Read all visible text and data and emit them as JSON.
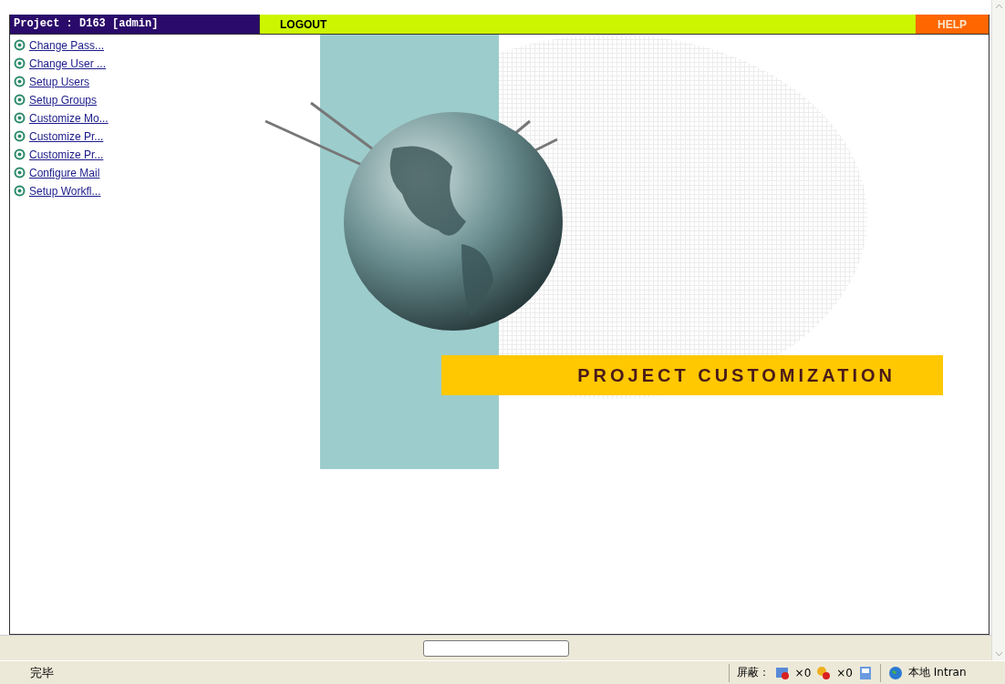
{
  "header": {
    "title": "Project : D163 [admin]",
    "logout": "LOGOUT",
    "help": "HELP"
  },
  "menu": [
    {
      "label": "Change Pass..."
    },
    {
      "label": "Change User ..."
    },
    {
      "label": "Setup Users"
    },
    {
      "label": "Setup Groups"
    },
    {
      "label": "Customize Mo..."
    },
    {
      "label": "Customize Pr..."
    },
    {
      "label": "Customize Pr..."
    },
    {
      "label": "Configure Mail"
    },
    {
      "label": "Setup Workfl..."
    }
  ],
  "banner": "PROJECT CUSTOMIZATION",
  "status_bar": {
    "message": "完毕",
    "blocked_label": "屏蔽：",
    "popups_blocked": "×0",
    "ads_blocked": "×0",
    "zone": "本地 Intran"
  }
}
